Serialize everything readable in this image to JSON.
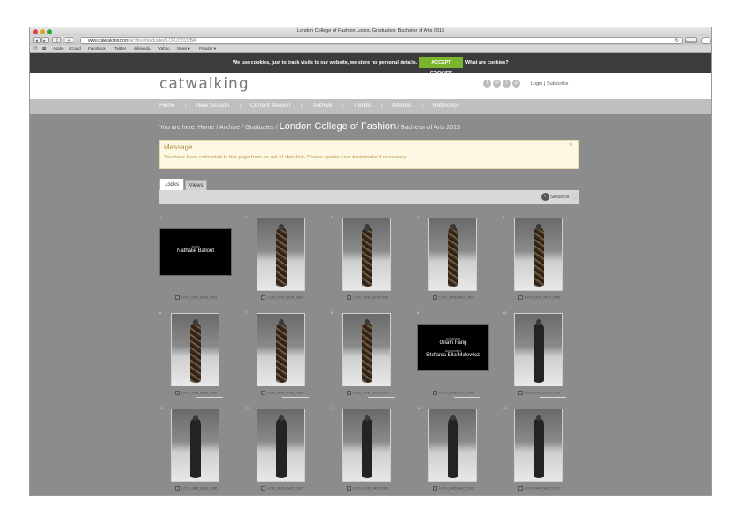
{
  "window": {
    "title": "London College of Fashion Looks, Graduates, Bachelor of Arts 2015"
  },
  "toolbar": {
    "url_host": "www.catwalking.com",
    "url_path": "/archive/graduates/LCFU/2015/BA",
    "reader_label": "Reader"
  },
  "bookmarks": [
    "Apple",
    "iCloud",
    "Facebook",
    "Twitter",
    "Wikipedia",
    "Yahoo",
    "News ▾",
    "Popular ▾"
  ],
  "cookie": {
    "text": "We use cookies, just to track visits to our website, we store no personal details.",
    "accept": "ACCEPT COOKIES",
    "link": "What are cookies?"
  },
  "header": {
    "logo": "catwalking",
    "social_icons": [
      "facebook-icon",
      "email-icon",
      "twitter-icon",
      "pinterest-icon"
    ],
    "login": "Login",
    "separator": "|",
    "subscribe": "Subscribe"
  },
  "nav": [
    "Home",
    "New Season",
    "Current Season",
    "Archive",
    "Trends",
    "Articles",
    "Reference"
  ],
  "breadcrumb": {
    "prefix": "You are here:",
    "items": [
      "Home",
      "Archive",
      "Graduates"
    ],
    "current": "London College of Fashion",
    "sub": "Bachelor of Arts 2015",
    "sep": "/"
  },
  "message": {
    "title": "Message",
    "text": "You have been redirected to this page from an out-of-date link. Please update your bookmarks if necessary.",
    "close": "×"
  },
  "tabs": {
    "looks": "Looks",
    "views": "Views",
    "seasons": "Seasons"
  },
  "grid": [
    {
      "num": "1",
      "kind": "card",
      "small": "studio",
      "names": [
        "Nathalie Ballout"
      ],
      "caption": "LCFU_GRD_BA15_0049"
    },
    {
      "num": "2",
      "kind": "photo",
      "caption": "LCFU_GRD_BA15_0083"
    },
    {
      "num": "3",
      "kind": "photo",
      "caption": "LCFU_GRD_BA15_0082"
    },
    {
      "num": "4",
      "kind": "photo",
      "caption": "LCFU_GRD_BA15_0093"
    },
    {
      "num": "5",
      "kind": "photo",
      "caption": "LCFU_GRD_BA15_0098"
    },
    {
      "num": "6",
      "kind": "photo",
      "caption": "LCFU_GRD_BA15_0119"
    },
    {
      "num": "7",
      "kind": "photo",
      "caption": "LCFU_GRD_BA15_0120"
    },
    {
      "num": "8",
      "kind": "photo",
      "caption": "LCFU_GRD_BA15_0148"
    },
    {
      "num": "9",
      "kind": "card",
      "small": "menswear",
      "names": [
        "Oilam Fang",
        "Stefania Ella Malewicz"
      ],
      "small2": "accessories",
      "caption": "LCFU_GRD_BA15_0158"
    },
    {
      "num": "10",
      "kind": "photo",
      "caption": "LCFU_GRD_BA15_0169"
    },
    {
      "num": "11",
      "kind": "photo",
      "caption": "LCFU_GRD_BA15_0180"
    },
    {
      "num": "12",
      "kind": "photo",
      "caption": "LCFU_GRD_BA15_0187"
    },
    {
      "num": "13",
      "kind": "photo",
      "caption": "LCFU_GRD_BA15_0198"
    },
    {
      "num": "14",
      "kind": "photo",
      "caption": "LCFU_GRD_BA15_0209"
    },
    {
      "num": "15",
      "kind": "photo",
      "caption": "LCFU_GRD_BA15_0221"
    }
  ]
}
